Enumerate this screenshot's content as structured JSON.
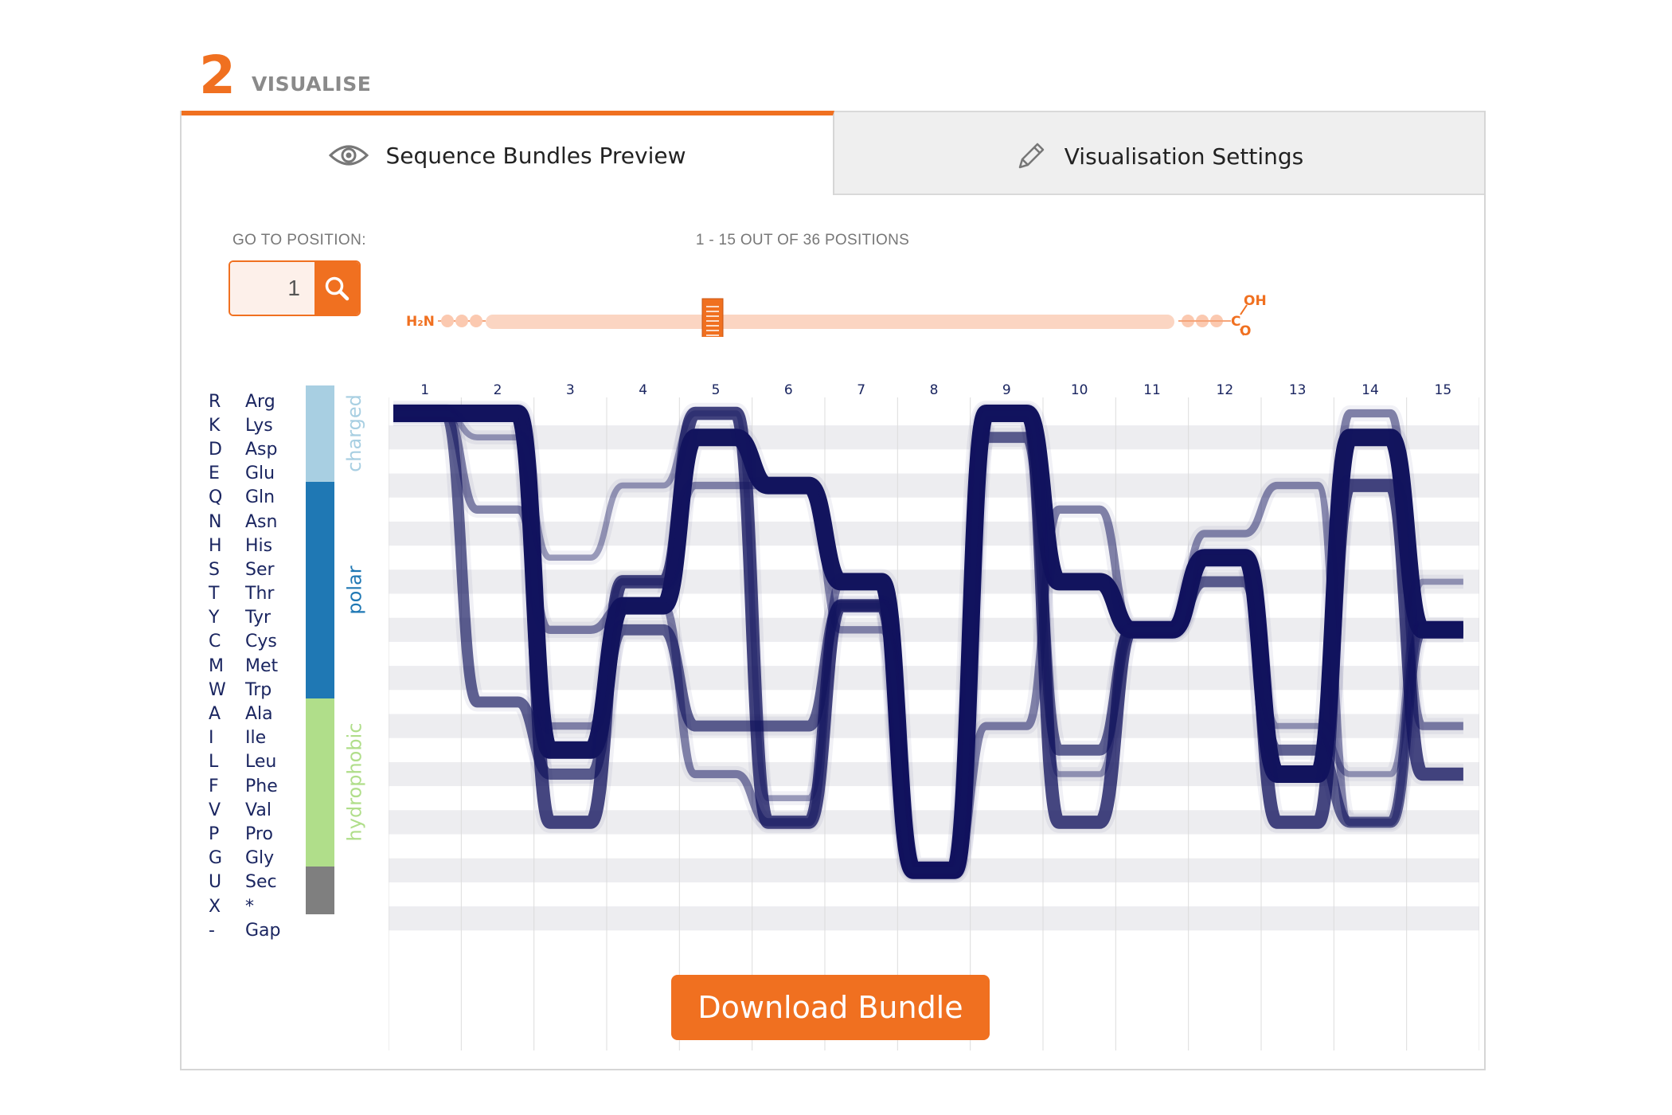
{
  "step": {
    "number": "2",
    "label": "VISUALISE"
  },
  "tabs": [
    {
      "label": "Sequence Bundles Preview",
      "icon": "eye-icon",
      "active": true
    },
    {
      "label": "Visualisation Settings",
      "icon": "pencil-icon",
      "active": false
    }
  ],
  "goto": {
    "label": "GO TO POSITION:",
    "value": "1",
    "button_icon": "search-icon"
  },
  "range": {
    "text": "1 - 15 OUT OF 36 POSITIONS",
    "start": 1,
    "end": 15,
    "total": 36
  },
  "terminals": {
    "n_label": "H₂N",
    "c_label": "C",
    "c_oh": "OH",
    "c_o": "O"
  },
  "residues": [
    {
      "code": "R",
      "name": "Arg"
    },
    {
      "code": "K",
      "name": "Lys"
    },
    {
      "code": "D",
      "name": "Asp"
    },
    {
      "code": "E",
      "name": "Glu"
    },
    {
      "code": "Q",
      "name": "Gln"
    },
    {
      "code": "N",
      "name": "Asn"
    },
    {
      "code": "H",
      "name": "His"
    },
    {
      "code": "S",
      "name": "Ser"
    },
    {
      "code": "T",
      "name": "Thr"
    },
    {
      "code": "Y",
      "name": "Tyr"
    },
    {
      "code": "C",
      "name": "Cys"
    },
    {
      "code": "M",
      "name": "Met"
    },
    {
      "code": "W",
      "name": "Trp"
    },
    {
      "code": "A",
      "name": "Ala"
    },
    {
      "code": "I",
      "name": "Ile"
    },
    {
      "code": "L",
      "name": "Leu"
    },
    {
      "code": "F",
      "name": "Phe"
    },
    {
      "code": "V",
      "name": "Val"
    },
    {
      "code": "P",
      "name": "Pro"
    },
    {
      "code": "G",
      "name": "Gly"
    },
    {
      "code": "U",
      "name": "Sec"
    },
    {
      "code": "X",
      "name": "*"
    },
    {
      "code": "-",
      "name": "Gap"
    }
  ],
  "classes": [
    {
      "name": "charged",
      "color": "#a8cfe2",
      "count": 4
    },
    {
      "name": "polar",
      "color": "#1f78b4",
      "count": 9
    },
    {
      "name": "hydrophobic",
      "color": "#b0de8a",
      "count": 7
    },
    {
      "name": "",
      "color": "#7f7f7f",
      "count": 2
    }
  ],
  "colors": {
    "accent": "#f07020",
    "bundle": "#14165e",
    "slider_track": "#fbd5c2"
  },
  "chart_data": {
    "type": "sequence-bundle",
    "positions": [
      1,
      2,
      3,
      4,
      5,
      6,
      7,
      8,
      9,
      10,
      11,
      12,
      13,
      14,
      15
    ],
    "rows": [
      "R",
      "K",
      "D",
      "E",
      "Q",
      "N",
      "H",
      "S",
      "T",
      "Y",
      "C",
      "M",
      "W",
      "A",
      "I",
      "L",
      "F",
      "V",
      "P",
      "G",
      "U",
      "X",
      "-"
    ],
    "bundles": [
      {
        "residues": [
          "R",
          "R",
          "I",
          "T",
          "K",
          "E",
          "S",
          "G",
          "R",
          "S",
          "Y",
          "H",
          "L",
          "K",
          "Y"
        ],
        "weight": 1.0
      },
      {
        "residues": [
          "R",
          "R",
          "V",
          "S",
          "R",
          "V",
          "T",
          "G",
          "R",
          "V",
          "Y",
          "H",
          "V",
          "E",
          "L"
        ],
        "weight": 0.7
      },
      {
        "residues": [
          "R",
          "W",
          "L",
          "Y",
          "A",
          "A",
          "T",
          "G",
          "K",
          "I",
          "Y",
          "S",
          "I",
          "V",
          "Y"
        ],
        "weight": 0.55
      },
      {
        "residues": [
          "R",
          "Q",
          "Y",
          "T",
          "L",
          "V",
          "S",
          "G",
          "A",
          "Q",
          "Y",
          "H",
          "L",
          "R",
          "A"
        ],
        "weight": 0.35
      },
      {
        "residues": [
          "R",
          "R",
          "A",
          "S",
          "E",
          "E",
          "Y",
          "G",
          "R",
          "S",
          "Y",
          "N",
          "E",
          "V",
          "Y"
        ],
        "weight": 0.3
      },
      {
        "residues": [
          "R",
          "K",
          "H",
          "E",
          "R",
          "F",
          "T",
          "G",
          "R",
          "L",
          "Y",
          "H",
          "A",
          "L",
          "S"
        ],
        "weight": 0.2
      }
    ]
  }
}
